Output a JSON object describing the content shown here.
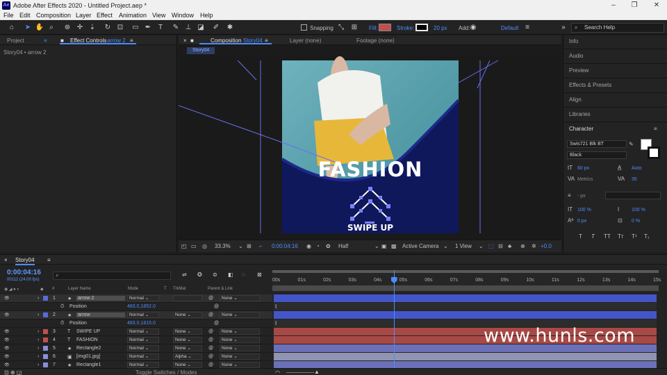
{
  "app": {
    "title": "Adobe After Effects 2020 - Untitled Project.aep *",
    "logo_text": "Ae",
    "window_controls": [
      "–",
      "❐",
      "✕"
    ]
  },
  "menu": [
    "File",
    "Edit",
    "Composition",
    "Layer",
    "Effect",
    "Animation",
    "View",
    "Window",
    "Help"
  ],
  "toolbar": {
    "snapping_label": "Snapping",
    "fill_label": "Fill:",
    "fill_color": "#c0504d",
    "stroke_label": "Stroke:",
    "stroke_width": "20 px",
    "add_label": "Add:",
    "workspace": "Default",
    "search_placeholder": "Search Help"
  },
  "left_panel": {
    "tab_project": "Project",
    "tab_effect_controls": "Effect Controls",
    "effect_target": "arrow 2",
    "subtitle": "Story04 • arrow 2"
  },
  "comp_panel": {
    "tab_label": "Composition",
    "comp_name": "Story04",
    "layer_tab": "Layer (none)",
    "footage_tab": "Footage (none)",
    "sub_tab": "Story04",
    "headline": "FASHION",
    "cta": "SWIPE UP",
    "zoom": "33.3%",
    "time": "0:00:04:16",
    "resolution": "Half",
    "camera": "Active Camera",
    "views": "1 View",
    "exposure": "+0.0"
  },
  "right_panel": {
    "items": [
      "Info",
      "Audio",
      "Preview",
      "Effects & Presets",
      "Align",
      "Libraries"
    ],
    "character_title": "Character",
    "font_family": "Swis721 Blk BT",
    "font_style": "Black",
    "font_size": "60 px",
    "leading": "Auto",
    "kerning": "Metrics",
    "tracking": "35",
    "stroke_px": "- px",
    "vscale": "100 %",
    "hscale": "100 %",
    "baseline": "0 px",
    "tsume": "0 %",
    "styles": [
      "T",
      "T",
      "TT",
      "Tт",
      "T¹",
      "T₁"
    ]
  },
  "timeline": {
    "tab": "Story04",
    "timecode": "0:00:04:16",
    "frame_info": "00112 (24.00 fps)",
    "columns": {
      "number": "#",
      "layer_name": "Layer Name",
      "mode": "Mode",
      "t": "T",
      "trkmat": "TrkMat",
      "parent": "Parent & Link"
    },
    "ruler": [
      "00s",
      "01s",
      "02s",
      "03s",
      "04s",
      "05s",
      "06s",
      "07s",
      "08s",
      "09s",
      "10s",
      "11s",
      "12s",
      "13s",
      "14s",
      "15s"
    ],
    "playhead_seconds": 4.67,
    "duration_seconds": 15,
    "layers": [
      {
        "num": "1",
        "name": "arrow 2",
        "type": "★",
        "mode": "Normal",
        "trkmat": "",
        "parent": "None",
        "color": "#5a6cd6",
        "bar": "#4356c9",
        "selected": true
      },
      {
        "num": "",
        "name": "Position",
        "prop": true,
        "value": "483.0,1852.0"
      },
      {
        "num": "2",
        "name": "arrow",
        "type": "★",
        "mode": "Normal",
        "trkmat": "None",
        "parent": "None",
        "color": "#5a6cd6",
        "bar": "#4356c9",
        "selected": true
      },
      {
        "num": "",
        "name": "Position",
        "prop": true,
        "value": "483.0,1815.0"
      },
      {
        "num": "3",
        "name": "SWIPE UP",
        "type": "T",
        "mode": "Normal",
        "trkmat": "None",
        "parent": "None",
        "color": "#c0504d",
        "bar": "#a84946"
      },
      {
        "num": "4",
        "name": "FASHION",
        "type": "T",
        "mode": "Normal",
        "trkmat": "None",
        "parent": "None",
        "color": "#c0504d",
        "bar": "#a84946"
      },
      {
        "num": "5",
        "name": "Rectangle2",
        "type": "★",
        "mode": "Normal",
        "trkmat": "None",
        "parent": "None",
        "color": "#8a8fd6",
        "bar": "#6b70b8"
      },
      {
        "num": "6",
        "name": "[img01.jpg]",
        "type": "▣",
        "mode": "Normal",
        "trkmat": "Alpha",
        "parent": "None",
        "color": "#8a8fd6",
        "bar": "#9094b0"
      },
      {
        "num": "7",
        "name": "Rectangle1",
        "type": "★",
        "mode": "Normal",
        "trkmat": "None",
        "parent": "None",
        "color": "#8a8fd6",
        "bar": "#6b70b8"
      }
    ],
    "bottom_label": "Toggle Switches / Modes"
  },
  "watermark": "www.hunls.com"
}
